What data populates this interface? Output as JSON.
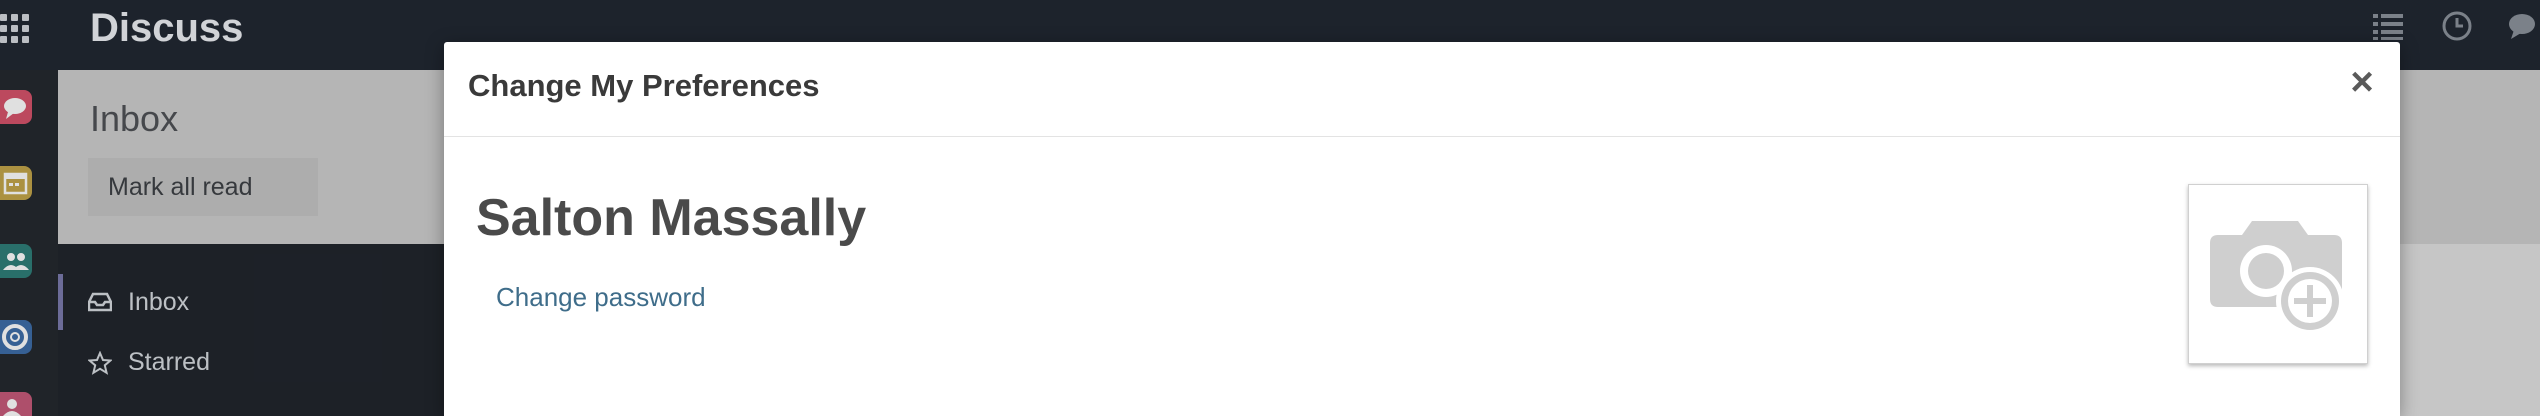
{
  "navbar": {
    "app_title": "Discuss",
    "icons": [
      "apps-grid-icon",
      "activity-list-icon",
      "clock-icon",
      "chat-icon"
    ]
  },
  "app_strip": {
    "tiles": [
      {
        "icon": "chat-bubble-icon",
        "color": "#d6546c"
      },
      {
        "icon": "calendar-icon",
        "color": "#c3a64b"
      },
      {
        "icon": "users-icon",
        "color": "#2f7f79"
      },
      {
        "icon": "lifebuoy-icon",
        "color": "#3e6ea9"
      },
      {
        "icon": "contact-icon",
        "color": "#c75b7a"
      }
    ]
  },
  "control_panel": {
    "title": "Inbox",
    "mark_all_read": "Mark all read"
  },
  "discuss_sidebar": {
    "items": [
      {
        "label": "Inbox",
        "icon": "inbox-icon",
        "active": true
      },
      {
        "label": "Starred",
        "icon": "star-icon",
        "active": false
      }
    ]
  },
  "modal": {
    "title": "Change My Preferences",
    "close_label": "×",
    "user_name": "Salton Massally",
    "change_password": "Change password",
    "avatar_icon": "camera-plus-icon"
  },
  "colors": {
    "navbar": "#212833",
    "sidebar": "#21262d",
    "active_bar": "#7c7bad",
    "link": "#3f6d8a"
  }
}
